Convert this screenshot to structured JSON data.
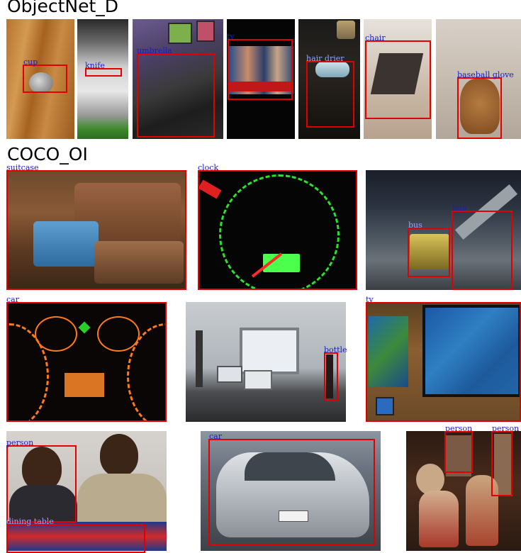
{
  "sections": {
    "objectnet": "ObjectNet_D",
    "coco": "COCO_OI"
  },
  "labels": {
    "cup": "cup",
    "knife": "knife",
    "umbrella": "umbrella",
    "tv_obj": "tv",
    "hair_drier": "hair drier",
    "chair": "chair",
    "baseball_glove": "baseball glove",
    "suitcase": "suitcase",
    "clock": "clock",
    "bus1": "bus",
    "bus2": "bus",
    "car_dash": "car",
    "bottle": "bottle",
    "tv_coco": "tv",
    "person1": "person",
    "dining_table": "dining table",
    "car_merc": "car",
    "person2": "person",
    "person3": "person"
  },
  "colors": {
    "box": "#e00000",
    "label": "#1a1acc"
  }
}
